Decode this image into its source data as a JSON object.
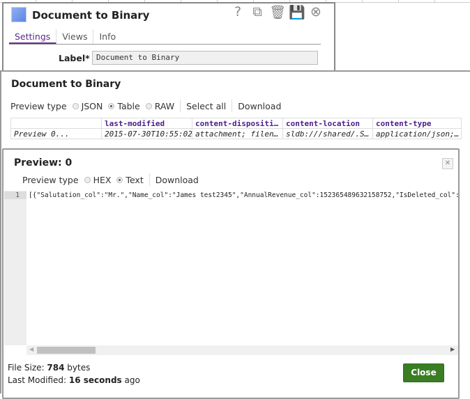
{
  "dialog": {
    "title": "Document to Binary",
    "tabs": [
      "Settings",
      "Views",
      "Info"
    ],
    "label_caption": "Label*",
    "label_value": "Document to Binary"
  },
  "panel": {
    "title": "Document to Binary",
    "preview_type_label": "Preview type",
    "options": [
      "JSON",
      "Table",
      "RAW"
    ],
    "selected": "Table",
    "select_all": "Select all",
    "download": "Download",
    "table": {
      "headers": [
        "",
        "last-modified",
        "content-dispositi…",
        "content-location",
        "content-type"
      ],
      "rows": [
        [
          "Preview 0...",
          "2015-07-30T10:55:02",
          "attachment; filen…",
          "sldb:///shared/.S…",
          "application/json;…"
        ]
      ]
    }
  },
  "preview": {
    "title": "Preview: 0",
    "preview_type_label": "Preview type",
    "options": [
      "HEX",
      "Text"
    ],
    "selected": "Text",
    "download": "Download",
    "line_number": "1",
    "code": "[{\"Salutation_col\":\"Mr.\",\"Name_col\":\"James test2345\",\"AnnualRevenue_col\":152365489632158752,\"IsDeleted_col\":fals",
    "file_size_label": "File Size:",
    "file_size": "784",
    "file_size_unit": "bytes",
    "last_modified_label": "Last Modified:",
    "last_modified": "16 seconds",
    "last_modified_suffix": "ago",
    "close": "Close"
  }
}
